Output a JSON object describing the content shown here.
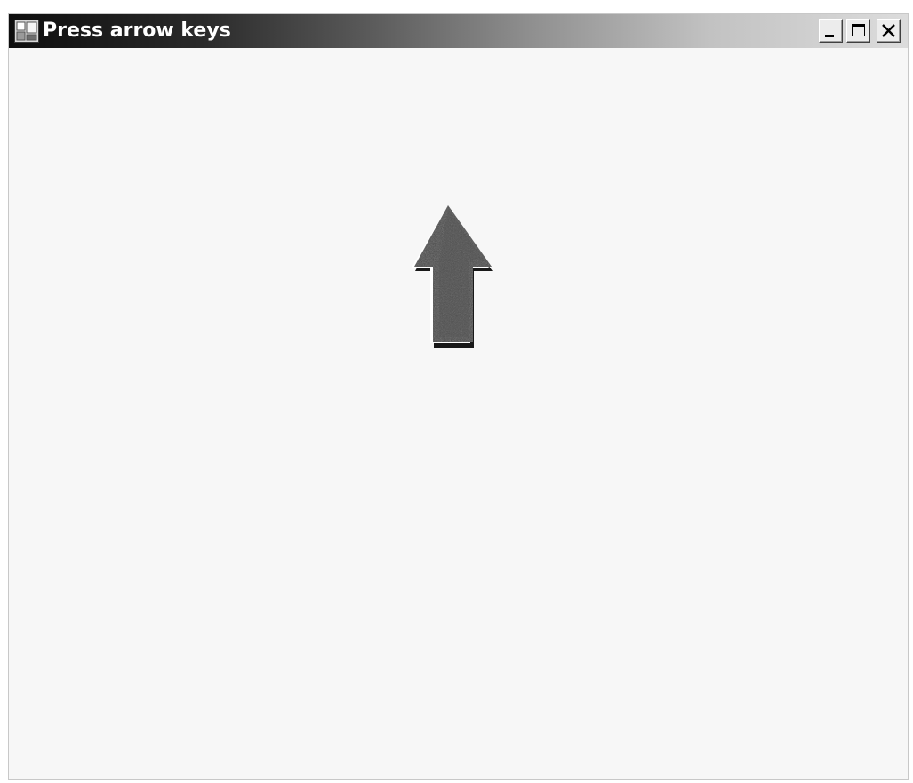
{
  "window": {
    "title": "Press arrow keys",
    "controls": {
      "minimize_icon": "minimize-icon",
      "maximize_icon": "maximize-icon",
      "close_icon": "close-icon"
    }
  },
  "client": {
    "arrow_icon": "arrow-up-icon",
    "arrow_direction": "up"
  },
  "colors": {
    "titlebar_start": "#0e0e0e",
    "titlebar_end": "#dcdcdc",
    "title_text": "#ffffff",
    "client_background": "#f7f7f7",
    "arrow_fill": "#4a4a4a"
  }
}
